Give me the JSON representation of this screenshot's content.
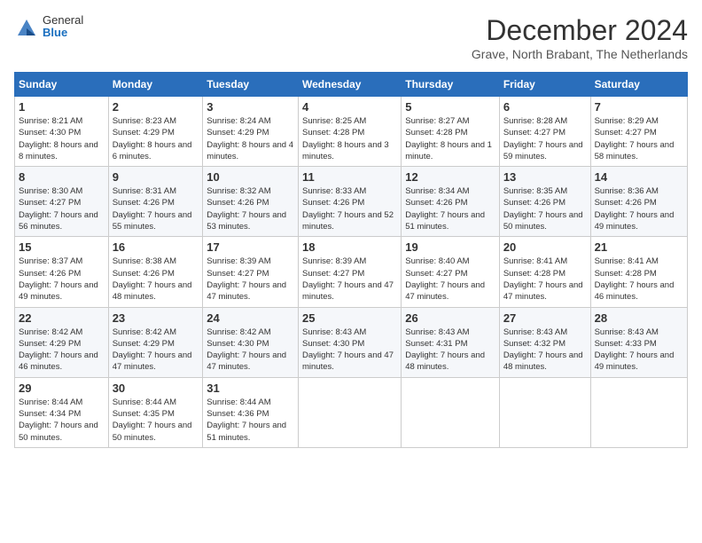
{
  "logo": {
    "general": "General",
    "blue": "Blue"
  },
  "title": "December 2024",
  "location": "Grave, North Brabant, The Netherlands",
  "days_of_week": [
    "Sunday",
    "Monday",
    "Tuesday",
    "Wednesday",
    "Thursday",
    "Friday",
    "Saturday"
  ],
  "weeks": [
    [
      {
        "day": "1",
        "sunrise": "Sunrise: 8:21 AM",
        "sunset": "Sunset: 4:30 PM",
        "daylight": "Daylight: 8 hours and 8 minutes."
      },
      {
        "day": "2",
        "sunrise": "Sunrise: 8:23 AM",
        "sunset": "Sunset: 4:29 PM",
        "daylight": "Daylight: 8 hours and 6 minutes."
      },
      {
        "day": "3",
        "sunrise": "Sunrise: 8:24 AM",
        "sunset": "Sunset: 4:29 PM",
        "daylight": "Daylight: 8 hours and 4 minutes."
      },
      {
        "day": "4",
        "sunrise": "Sunrise: 8:25 AM",
        "sunset": "Sunset: 4:28 PM",
        "daylight": "Daylight: 8 hours and 3 minutes."
      },
      {
        "day": "5",
        "sunrise": "Sunrise: 8:27 AM",
        "sunset": "Sunset: 4:28 PM",
        "daylight": "Daylight: 8 hours and 1 minute."
      },
      {
        "day": "6",
        "sunrise": "Sunrise: 8:28 AM",
        "sunset": "Sunset: 4:27 PM",
        "daylight": "Daylight: 7 hours and 59 minutes."
      },
      {
        "day": "7",
        "sunrise": "Sunrise: 8:29 AM",
        "sunset": "Sunset: 4:27 PM",
        "daylight": "Daylight: 7 hours and 58 minutes."
      }
    ],
    [
      {
        "day": "8",
        "sunrise": "Sunrise: 8:30 AM",
        "sunset": "Sunset: 4:27 PM",
        "daylight": "Daylight: 7 hours and 56 minutes."
      },
      {
        "day": "9",
        "sunrise": "Sunrise: 8:31 AM",
        "sunset": "Sunset: 4:26 PM",
        "daylight": "Daylight: 7 hours and 55 minutes."
      },
      {
        "day": "10",
        "sunrise": "Sunrise: 8:32 AM",
        "sunset": "Sunset: 4:26 PM",
        "daylight": "Daylight: 7 hours and 53 minutes."
      },
      {
        "day": "11",
        "sunrise": "Sunrise: 8:33 AM",
        "sunset": "Sunset: 4:26 PM",
        "daylight": "Daylight: 7 hours and 52 minutes."
      },
      {
        "day": "12",
        "sunrise": "Sunrise: 8:34 AM",
        "sunset": "Sunset: 4:26 PM",
        "daylight": "Daylight: 7 hours and 51 minutes."
      },
      {
        "day": "13",
        "sunrise": "Sunrise: 8:35 AM",
        "sunset": "Sunset: 4:26 PM",
        "daylight": "Daylight: 7 hours and 50 minutes."
      },
      {
        "day": "14",
        "sunrise": "Sunrise: 8:36 AM",
        "sunset": "Sunset: 4:26 PM",
        "daylight": "Daylight: 7 hours and 49 minutes."
      }
    ],
    [
      {
        "day": "15",
        "sunrise": "Sunrise: 8:37 AM",
        "sunset": "Sunset: 4:26 PM",
        "daylight": "Daylight: 7 hours and 49 minutes."
      },
      {
        "day": "16",
        "sunrise": "Sunrise: 8:38 AM",
        "sunset": "Sunset: 4:26 PM",
        "daylight": "Daylight: 7 hours and 48 minutes."
      },
      {
        "day": "17",
        "sunrise": "Sunrise: 8:39 AM",
        "sunset": "Sunset: 4:27 PM",
        "daylight": "Daylight: 7 hours and 47 minutes."
      },
      {
        "day": "18",
        "sunrise": "Sunrise: 8:39 AM",
        "sunset": "Sunset: 4:27 PM",
        "daylight": "Daylight: 7 hours and 47 minutes."
      },
      {
        "day": "19",
        "sunrise": "Sunrise: 8:40 AM",
        "sunset": "Sunset: 4:27 PM",
        "daylight": "Daylight: 7 hours and 47 minutes."
      },
      {
        "day": "20",
        "sunrise": "Sunrise: 8:41 AM",
        "sunset": "Sunset: 4:28 PM",
        "daylight": "Daylight: 7 hours and 47 minutes."
      },
      {
        "day": "21",
        "sunrise": "Sunrise: 8:41 AM",
        "sunset": "Sunset: 4:28 PM",
        "daylight": "Daylight: 7 hours and 46 minutes."
      }
    ],
    [
      {
        "day": "22",
        "sunrise": "Sunrise: 8:42 AM",
        "sunset": "Sunset: 4:29 PM",
        "daylight": "Daylight: 7 hours and 46 minutes."
      },
      {
        "day": "23",
        "sunrise": "Sunrise: 8:42 AM",
        "sunset": "Sunset: 4:29 PM",
        "daylight": "Daylight: 7 hours and 47 minutes."
      },
      {
        "day": "24",
        "sunrise": "Sunrise: 8:42 AM",
        "sunset": "Sunset: 4:30 PM",
        "daylight": "Daylight: 7 hours and 47 minutes."
      },
      {
        "day": "25",
        "sunrise": "Sunrise: 8:43 AM",
        "sunset": "Sunset: 4:30 PM",
        "daylight": "Daylight: 7 hours and 47 minutes."
      },
      {
        "day": "26",
        "sunrise": "Sunrise: 8:43 AM",
        "sunset": "Sunset: 4:31 PM",
        "daylight": "Daylight: 7 hours and 48 minutes."
      },
      {
        "day": "27",
        "sunrise": "Sunrise: 8:43 AM",
        "sunset": "Sunset: 4:32 PM",
        "daylight": "Daylight: 7 hours and 48 minutes."
      },
      {
        "day": "28",
        "sunrise": "Sunrise: 8:43 AM",
        "sunset": "Sunset: 4:33 PM",
        "daylight": "Daylight: 7 hours and 49 minutes."
      }
    ],
    [
      {
        "day": "29",
        "sunrise": "Sunrise: 8:44 AM",
        "sunset": "Sunset: 4:34 PM",
        "daylight": "Daylight: 7 hours and 50 minutes."
      },
      {
        "day": "30",
        "sunrise": "Sunrise: 8:44 AM",
        "sunset": "Sunset: 4:35 PM",
        "daylight": "Daylight: 7 hours and 50 minutes."
      },
      {
        "day": "31",
        "sunrise": "Sunrise: 8:44 AM",
        "sunset": "Sunset: 4:36 PM",
        "daylight": "Daylight: 7 hours and 51 minutes."
      },
      null,
      null,
      null,
      null
    ]
  ]
}
